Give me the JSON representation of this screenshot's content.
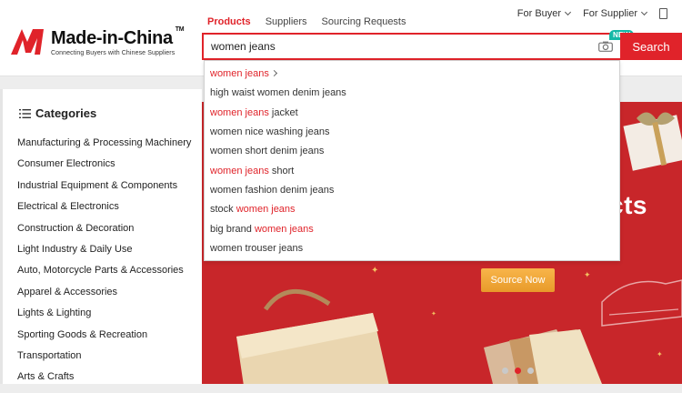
{
  "logo": {
    "name": "Made-in-China",
    "tm": "TM",
    "tagline": "Connecting Buyers with Chinese Suppliers"
  },
  "nav": {
    "tabs": [
      {
        "label": "Products"
      },
      {
        "label": "Suppliers"
      },
      {
        "label": "Sourcing Requests"
      }
    ]
  },
  "top_right": {
    "for_buyer": "For Buyer",
    "for_supplier": "For Supplier"
  },
  "search": {
    "value": "women jeans",
    "button": "Search",
    "badge": "NEW"
  },
  "suggestions": [
    {
      "parts": [
        {
          "t": "women jeans",
          "hl": true
        }
      ],
      "arrow": true
    },
    {
      "parts": [
        {
          "t": "high waist women denim jeans",
          "hl": false
        }
      ]
    },
    {
      "parts": [
        {
          "t": "women jeans",
          "hl": true
        },
        {
          "t": " jacket",
          "hl": false
        }
      ]
    },
    {
      "parts": [
        {
          "t": "women nice washing jeans",
          "hl": false
        }
      ]
    },
    {
      "parts": [
        {
          "t": "women short denim jeans",
          "hl": false
        }
      ]
    },
    {
      "parts": [
        {
          "t": "women jeans",
          "hl": true
        },
        {
          "t": " short",
          "hl": false
        }
      ]
    },
    {
      "parts": [
        {
          "t": "women fashion denim jeans",
          "hl": false
        }
      ]
    },
    {
      "parts": [
        {
          "t": "stock ",
          "hl": false
        },
        {
          "t": "women jeans",
          "hl": true
        }
      ]
    },
    {
      "parts": [
        {
          "t": "big brand ",
          "hl": false
        },
        {
          "t": "women jeans",
          "hl": true
        }
      ]
    },
    {
      "parts": [
        {
          "t": "women trouser jeans",
          "hl": false
        }
      ]
    }
  ],
  "categories": {
    "title": "Categories",
    "items": [
      "Manufacturing & Processing Machinery",
      "Consumer Electronics",
      "Industrial Equipment & Components",
      "Electrical & Electronics",
      "Construction & Decoration",
      "Light Industry & Daily Use",
      "Auto, Motorcycle Parts & Accessories",
      "Apparel & Accessories",
      "Lights & Lighting",
      "Sporting Goods & Recreation",
      "Transportation",
      "Arts & Crafts"
    ]
  },
  "banner": {
    "title_fragment": "cts",
    "cta": "Source Now",
    "slides": 3,
    "active_slide": 2
  },
  "colors": {
    "brand_red": "#e0232a",
    "banner_red": "#c8262a",
    "cta_orange": "#f5a623",
    "badge_teal": "#14b8a6"
  }
}
